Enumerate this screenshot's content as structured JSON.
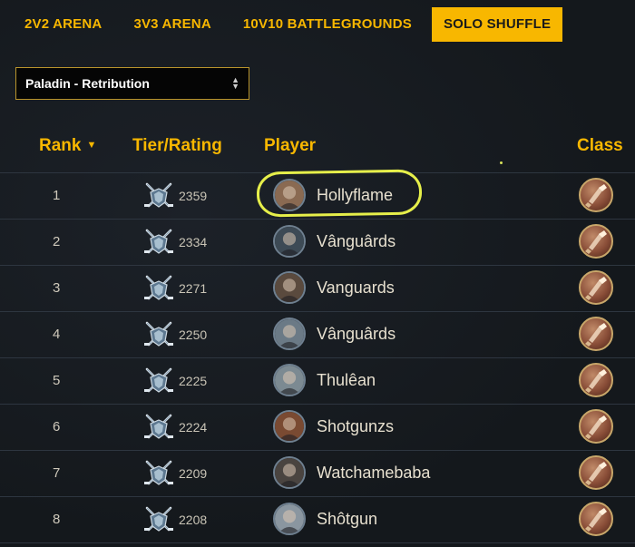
{
  "tabs": [
    {
      "label": "2V2 ARENA",
      "active": false
    },
    {
      "label": "3V3 ARENA",
      "active": false
    },
    {
      "label": "10V10 BATTLEGROUNDS",
      "active": false
    },
    {
      "label": "SOLO SHUFFLE",
      "active": true
    }
  ],
  "spec_select": {
    "value": "Paladin - Retribution"
  },
  "table": {
    "headers": {
      "rank": "Rank",
      "tier": "Tier/Rating",
      "player": "Player",
      "class": "Class"
    },
    "rows": [
      {
        "rank": "1",
        "rating": "2359",
        "player": "Hollyflame",
        "avatar_color": "#8a6a52",
        "class_icon": "paladin-icon"
      },
      {
        "rank": "2",
        "rating": "2334",
        "player": "Vânguârds",
        "avatar_color": "#3d4a55",
        "class_icon": "paladin-icon"
      },
      {
        "rank": "3",
        "rating": "2271",
        "player": "Vanguards",
        "avatar_color": "#5a4a3e",
        "class_icon": "paladin-icon"
      },
      {
        "rank": "4",
        "rating": "2250",
        "player": "Vânguârds",
        "avatar_color": "#6b7a86",
        "class_icon": "paladin-icon"
      },
      {
        "rank": "5",
        "rating": "2225",
        "player": "Thulêan",
        "avatar_color": "#7c8a92",
        "class_icon": "paladin-icon"
      },
      {
        "rank": "6",
        "rating": "2224",
        "player": "Shotgunzs",
        "avatar_color": "#7a4a32",
        "class_icon": "paladin-icon"
      },
      {
        "rank": "7",
        "rating": "2209",
        "player": "Watchamebaba",
        "avatar_color": "#4a4440",
        "class_icon": "paladin-icon"
      },
      {
        "rank": "8",
        "rating": "2208",
        "player": "Shôtgun",
        "avatar_color": "#8a96a0",
        "class_icon": "paladin-icon"
      }
    ]
  },
  "colors": {
    "accent": "#f8b700",
    "highlight": "#e6ef4a",
    "background": "#15191e"
  }
}
